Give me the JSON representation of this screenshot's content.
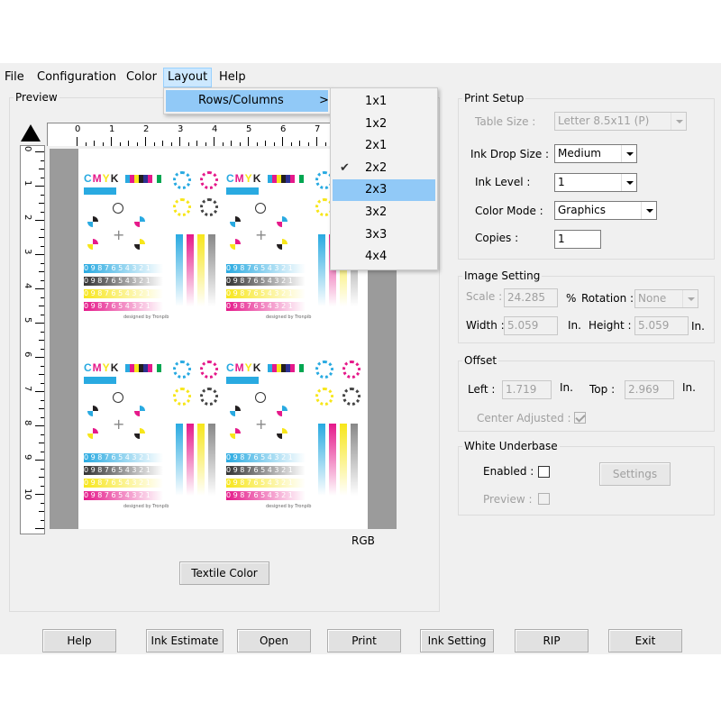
{
  "menubar": {
    "items": [
      "File",
      "Configuration",
      "Color",
      "Layout",
      "Help"
    ]
  },
  "layout_menu": {
    "items": [
      {
        "label": "Rows/Columns",
        "arrow": ">"
      }
    ],
    "submenu": [
      {
        "label": "1x1",
        "checked": false,
        "highlighted": false
      },
      {
        "label": "1x2",
        "checked": false,
        "highlighted": false
      },
      {
        "label": "2x1",
        "checked": false,
        "highlighted": false
      },
      {
        "label": "2x2",
        "checked": true,
        "highlighted": false
      },
      {
        "label": "2x3",
        "checked": false,
        "highlighted": true
      },
      {
        "label": "3x2",
        "checked": false,
        "highlighted": false
      },
      {
        "label": "3x3",
        "checked": false,
        "highlighted": false
      },
      {
        "label": "4x4",
        "checked": false,
        "highlighted": false
      }
    ]
  },
  "preview": {
    "legend": "Preview",
    "ruler_h": [
      "0",
      "1",
      "2",
      "3",
      "4",
      "5",
      "6",
      "7"
    ],
    "ruler_v": [
      "0",
      "1",
      "2",
      "3",
      "4",
      "5",
      "6",
      "7",
      "8",
      "9",
      "10"
    ],
    "color_space": "RGB",
    "textile_button": "Textile Color",
    "tile": {
      "cmyk": "CMYK",
      "ramp_rows": [
        {
          "text": "0 9 8 7 6 5 4 3 2 1",
          "color": "#29aae1"
        },
        {
          "text": "0 9 8 7 6 5 4 3 2 1",
          "color": "#333333"
        },
        {
          "text": "0 9 8 7 6 5 4 3 2 1",
          "color": "#f7e61a"
        },
        {
          "text": "0 9 8 7 6 5 4 3 2 1",
          "color": "#e5198a"
        }
      ],
      "footer": "designed by Tronpib"
    }
  },
  "print_setup": {
    "legend": "Print Setup",
    "table_size_label": "Table Size :",
    "table_size_value": "Letter 8.5x11 (P)",
    "ink_drop_label": "Ink Drop Size :",
    "ink_drop_value": "Medium",
    "ink_level_label": "Ink Level :",
    "ink_level_value": "1",
    "color_mode_label": "Color Mode :",
    "color_mode_value": "Graphics",
    "copies_label": "Copies :",
    "copies_value": "1"
  },
  "image_setting": {
    "legend": "Image Setting",
    "scale_label": "Scale :",
    "scale_value": "24.285",
    "pct": "%",
    "rotation_label": "Rotation :",
    "rotation_value": "None",
    "width_label": "Width :",
    "width_value": "5.059",
    "width_unit": "In.",
    "height_label": "Height :",
    "height_value": "5.059",
    "height_unit": "In."
  },
  "offset": {
    "legend": "Offset",
    "left_label": "Left :",
    "left_value": "1.719",
    "left_unit": "In.",
    "top_label": "Top :",
    "top_value": "2.969",
    "top_unit": "In.",
    "center_label": "Center Adjusted :",
    "center_checked": true
  },
  "white_underbase": {
    "legend": "White Underbase",
    "enabled_label": "Enabled :",
    "preview_label": "Preview :",
    "settings_button": "Settings"
  },
  "bottom_buttons": [
    "Help",
    "Ink Estimate",
    "Open",
    "Print",
    "Ink Setting",
    "RIP",
    "Exit"
  ],
  "colors": {
    "cyan": "#29aae1",
    "magenta": "#e5198a",
    "yellow": "#f7e61a",
    "black": "#231f20",
    "highlight": "#91c9f7",
    "menu_active": "#cce8ff"
  }
}
